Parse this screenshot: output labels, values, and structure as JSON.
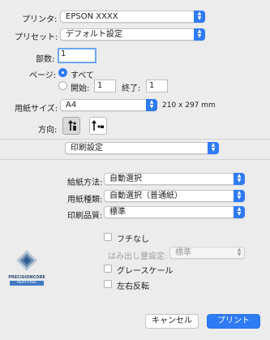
{
  "printer": {
    "label": "プリンタ:",
    "value": "EPSON XXXX"
  },
  "preset": {
    "label": "プリセット:",
    "value": "デフォルト設定"
  },
  "copies": {
    "label": "部数:",
    "value": "1"
  },
  "pages": {
    "label": "ページ:",
    "all_label": "すべて",
    "from_label": "開始:",
    "from_value": "1",
    "to_label": "終了:",
    "to_value": "1"
  },
  "paper": {
    "label": "用紙サイズ:",
    "value": "A4",
    "dimensions": "210 x 297 mm"
  },
  "orientation": {
    "label": "方向:",
    "selected": "portrait"
  },
  "section": {
    "value": "印刷設定"
  },
  "settings": {
    "feed_label": "給紙方法:",
    "feed_value": "自動選択",
    "media_label": "用紙種類:",
    "media_value": "自動選択（普通紙）",
    "quality_label": "印刷品質:",
    "quality_value": "標準"
  },
  "borderless": {
    "label": "フチなし",
    "checked": false
  },
  "expansion": {
    "label": "はみ出し量設定:",
    "value": "標準"
  },
  "grayscale": {
    "label": "グレースケール",
    "checked": false
  },
  "mirror": {
    "label": "左右反転",
    "checked": false
  },
  "logo": {
    "line1": "PRECISIONCORE",
    "line2": "HEAT-FREE"
  },
  "buttons": {
    "cancel": "キャンセル",
    "print": "プリント"
  },
  "colors": {
    "accent": "#2f7bf5",
    "background": "#ececec",
    "focus_ring": "#6ea5f3"
  }
}
